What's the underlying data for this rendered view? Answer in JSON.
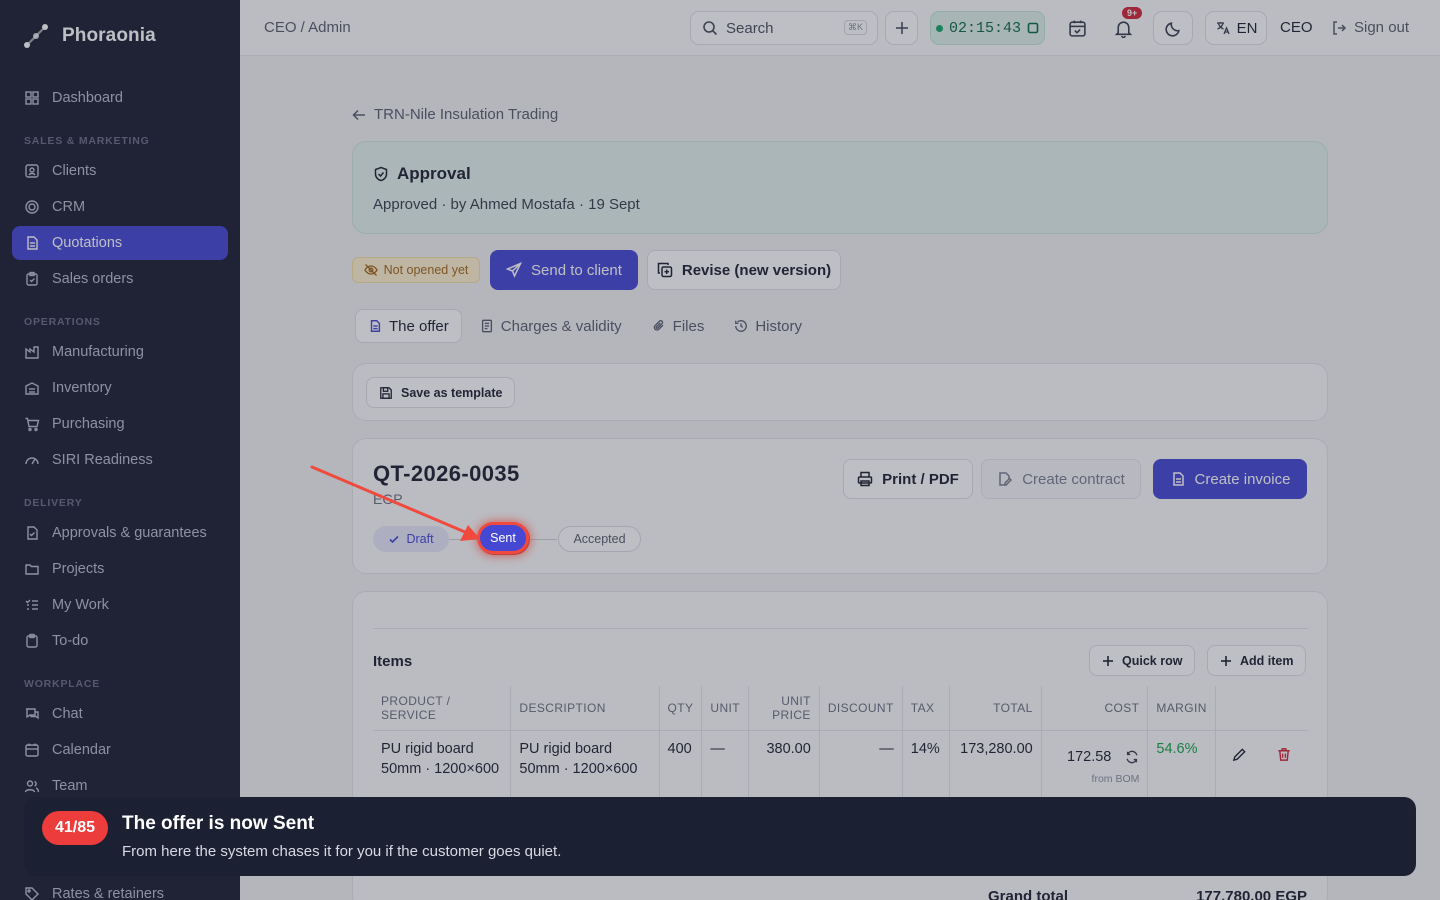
{
  "app": {
    "name": "Phoraonia"
  },
  "sidebar": {
    "dashboard": "Dashboard",
    "sections": {
      "sales": "SALES & MARKETING",
      "operations": "OPERATIONS",
      "delivery": "DELIVERY",
      "workplace": "WORKPLACE"
    },
    "items": {
      "clients": "Clients",
      "crm": "CRM",
      "quotations": "Quotations",
      "sales_orders": "Sales orders",
      "manufacturing": "Manufacturing",
      "inventory": "Inventory",
      "purchasing": "Purchasing",
      "siri": "SIRI Readiness",
      "approvals": "Approvals & guarantees",
      "projects": "Projects",
      "my_work": "My Work",
      "todo": "To-do",
      "chat": "Chat",
      "calendar": "Calendar",
      "team": "Team",
      "rates": "Rates & retainers"
    }
  },
  "topbar": {
    "breadcrumb": "CEO / Admin",
    "search_placeholder": "Search",
    "search_shortcut": "⌘K",
    "timer": "02:15:43",
    "notifications_badge": "9+",
    "language": "EN",
    "role": "CEO",
    "sign_out": "Sign out"
  },
  "page": {
    "back_link": "TRN-Nile Insulation Trading",
    "approval": {
      "title": "Approval",
      "subtitle": "Approved · by Ahmed Mostafa · 19 Sept"
    },
    "status_pill": "Not opened yet",
    "actions": {
      "send": "Send to client",
      "revise": "Revise (new version)"
    },
    "tabs": [
      "The offer",
      "Charges & validity",
      "Files",
      "History"
    ],
    "save_template": "Save as template",
    "quote": {
      "number": "QT-2026-0035",
      "currency": "EGP",
      "print": "Print / PDF",
      "create_contract": "Create contract",
      "create_invoice": "Create invoice",
      "steps": [
        "Draft",
        "Sent",
        "Accepted"
      ]
    },
    "items": {
      "title": "Items",
      "quick_row": "Quick row",
      "add_item": "Add item",
      "headers": {
        "product": "PRODUCT / SERVICE",
        "description": "DESCRIPTION",
        "qty": "QTY",
        "unit": "UNIT",
        "unit_price": "UNIT PRICE",
        "discount": "DISCOUNT",
        "tax": "TAX",
        "total": "TOTAL",
        "cost": "COST",
        "margin": "MARGIN"
      },
      "rows": [
        {
          "product": "PU rigid board 50mm · 1200×600",
          "description": "PU rigid board 50mm · 1200×600",
          "qty": "400",
          "unit": "—",
          "unit_price": "380.00",
          "discount": "—",
          "tax": "14%",
          "total": "173,280.00",
          "cost": "172.58",
          "cost_note": "from BOM",
          "margin": "54.6%"
        }
      ],
      "grand_total_label": "Grand total",
      "grand_total_value": "177,780.00 EGP"
    }
  },
  "toast": {
    "counter": "41/85",
    "title": "The offer is now Sent",
    "message": "From here the system chases it for you if the customer goes quiet."
  },
  "colors": {
    "accent": "#4648d4",
    "sidebar_bg": "#1c2033",
    "highlight": "#ec3c3c",
    "margin_green": "#16a34a"
  }
}
